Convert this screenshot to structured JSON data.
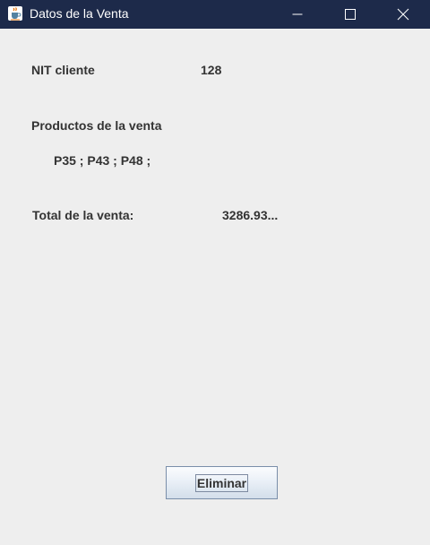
{
  "window": {
    "title": "Datos de la Venta",
    "icons": {
      "app": "java-cup-icon",
      "minimize": "minimize-icon",
      "maximize": "maximize-icon",
      "close": "close-icon"
    },
    "colors": {
      "titlebar": "#1d2a4a",
      "background": "#eeeeee",
      "text": "#333333"
    }
  },
  "sale": {
    "nit_label": "NIT cliente",
    "nit_value": "128",
    "products_label": "Productos de la venta",
    "products_value": "P35 ; P43 ; P48 ;",
    "total_label": "Total de la venta:",
    "total_value": "3286.93..."
  },
  "actions": {
    "delete_label": "Eliminar"
  }
}
